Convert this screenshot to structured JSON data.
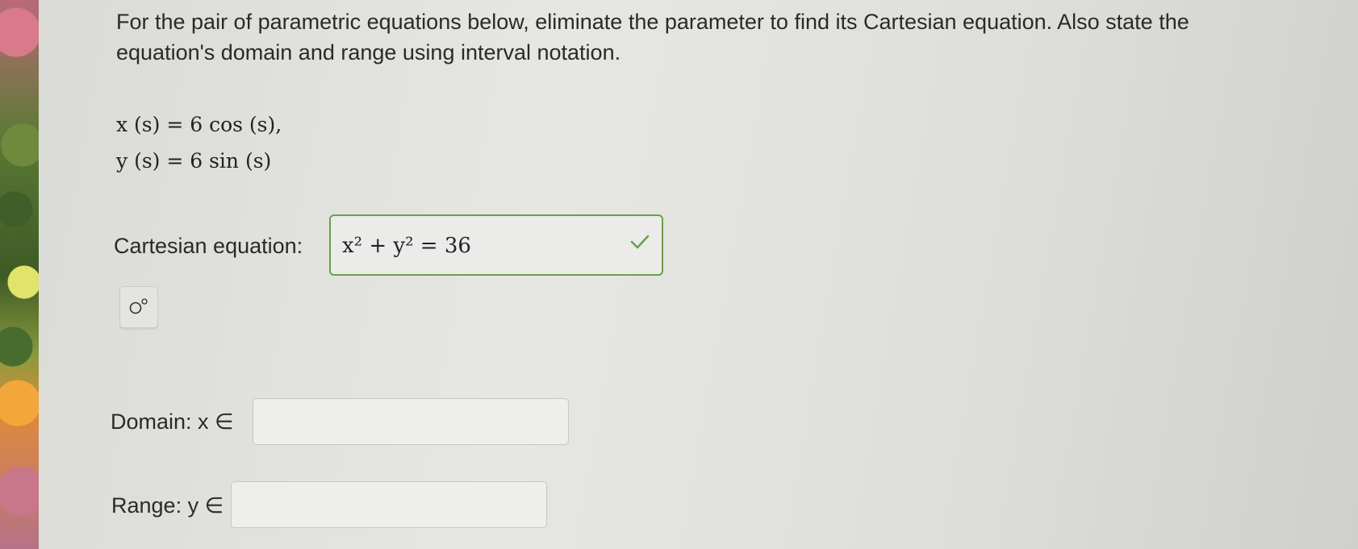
{
  "question": {
    "instructions": "For the pair of parametric equations below, eliminate the parameter to find its Cartesian equation. Also state the equation's domain and range using interval notation.",
    "equation_x": "x (s) = 6 cos (s),",
    "equation_y": "y (s) = 6 sin (s)"
  },
  "cartesian": {
    "label": "Cartesian equation:",
    "answer": "x² + y² = 36",
    "status_color": "#6aa04a"
  },
  "toolbar": {
    "symbol_button_icon": "symbol-palette-icon"
  },
  "domain": {
    "label": "Domain: x ∈",
    "value": ""
  },
  "range": {
    "label": "Range: y ∈",
    "value": ""
  }
}
